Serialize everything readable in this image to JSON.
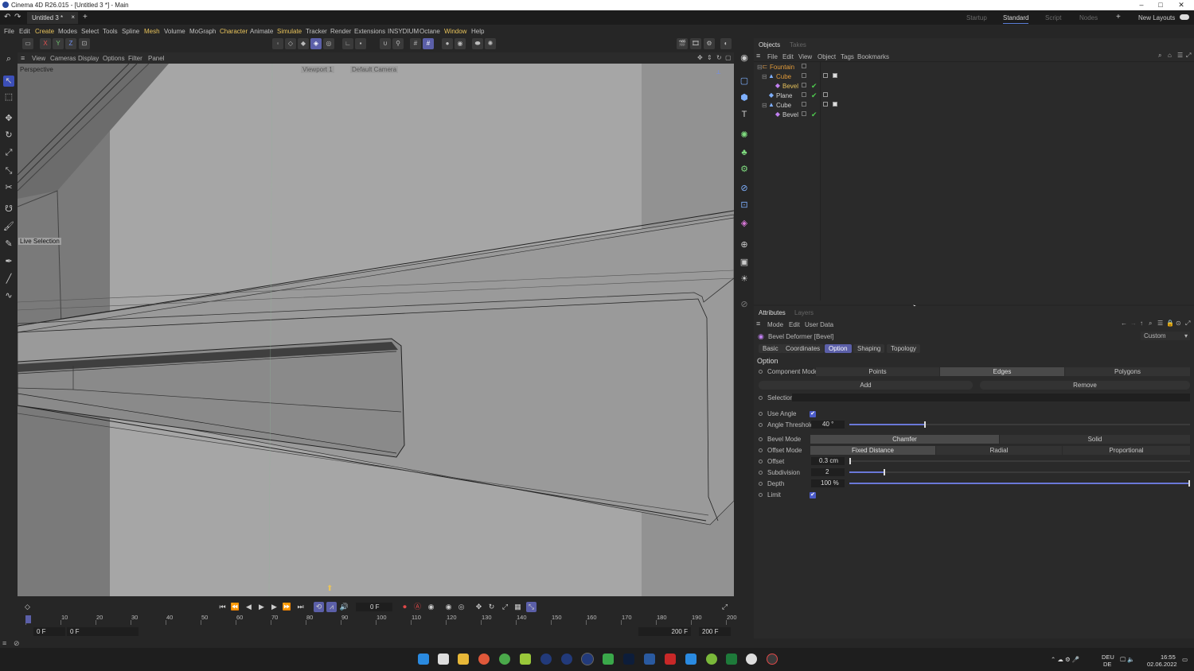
{
  "window": {
    "title": "Cinema 4D R26.015 - [Untitled 3 *] - Main",
    "controls": [
      "–",
      "□",
      "✕"
    ]
  },
  "tabbar": {
    "doc_tab": "Untitled 3 *",
    "close": "×",
    "add": "+",
    "layouts": [
      "Startup",
      "Standard",
      "Script",
      "Nodes"
    ],
    "active_layout": "Standard",
    "add_layout": "+",
    "new_layouts": "New Layouts"
  },
  "menubar": [
    "File",
    "Edit",
    "Create",
    "Modes",
    "Select",
    "Tools",
    "Spline",
    "Mesh",
    "Volume",
    "MoGraph",
    "Character",
    "Animate",
    "Simulate",
    "Tracker",
    "Render",
    "Extensions",
    "INSYDIUM",
    "Octane",
    "Window",
    "Help"
  ],
  "toolbar": {
    "axis_buttons": [
      "X",
      "Y",
      "Z"
    ]
  },
  "viewport_menu": [
    "View",
    "Cameras",
    "Display",
    "Options",
    "Filter",
    "Panel"
  ],
  "viewport": {
    "name": "Perspective",
    "viewport_label": "Viewport 1",
    "camera_label": "Default Camera",
    "tool_hint": "Live Selection"
  },
  "objects_panel": {
    "tabs": [
      "Objects",
      "Takes"
    ],
    "menu": [
      "File",
      "Edit",
      "View",
      "Object",
      "Tags",
      "Bookmarks"
    ],
    "tree": [
      {
        "name": "Fountain",
        "indent": 0,
        "color": "orange",
        "icon": "null-icon",
        "check": false
      },
      {
        "name": "Cube",
        "indent": 1,
        "color": "orange",
        "icon": "cube-icon",
        "check": true
      },
      {
        "name": "Bevel",
        "indent": 2,
        "color": "yellow",
        "icon": "bevel-icon",
        "check": true
      },
      {
        "name": "Plane",
        "indent": 1,
        "color": "white",
        "icon": "plane-icon",
        "check": true
      },
      {
        "name": "Cube",
        "indent": 1,
        "color": "white",
        "icon": "cube-icon",
        "check": false
      },
      {
        "name": "Bevel",
        "indent": 2,
        "color": "white",
        "icon": "bevel-icon",
        "check": true
      }
    ]
  },
  "attributes": {
    "tabs": [
      "Attributes",
      "Layers"
    ],
    "menu": [
      "Mode",
      "Edit",
      "User Data"
    ],
    "object_label": "Bevel Deformer [Bevel]",
    "preset": "Custom",
    "sub_tabs": [
      "Basic",
      "Coordinates",
      "Option",
      "Shaping",
      "Topology"
    ],
    "active_sub_tab": "Option",
    "section": "Option",
    "component_mode": {
      "label": "Component Mode",
      "options": [
        "Points",
        "Edges",
        "Polygons"
      ],
      "selected": "Edges"
    },
    "add_label": "Add",
    "remove_label": "Remove",
    "selection_label": "Selection",
    "use_angle": {
      "label": "Use Angle",
      "checked": true
    },
    "angle_threshold": {
      "label": "Angle Threshold",
      "value": "40 °",
      "fraction": 0.22
    },
    "bevel_mode": {
      "label": "Bevel Mode",
      "options": [
        "Chamfer",
        "Solid"
      ],
      "selected": "Chamfer"
    },
    "offset_mode": {
      "label": "Offset Mode",
      "options": [
        "Fixed Distance",
        "Radial",
        "Proportional"
      ],
      "selected": "Fixed Distance"
    },
    "offset": {
      "label": "Offset",
      "value": "0.3 cm",
      "fraction": 0.0
    },
    "subdivision": {
      "label": "Subdivision",
      "value": "2",
      "fraction": 0.1
    },
    "depth": {
      "label": "Depth",
      "value": "100 %",
      "fraction": 1.0
    },
    "limit": {
      "label": "Limit",
      "checked": true
    }
  },
  "timeline": {
    "current_frame": "0 F",
    "ticks": [
      "0",
      "10",
      "20",
      "30",
      "40",
      "50",
      "60",
      "70",
      "80",
      "90",
      "100",
      "110",
      "120",
      "130",
      "140",
      "150",
      "160",
      "170",
      "180",
      "190",
      "200"
    ],
    "start": "0 F",
    "preview_start": "0 F",
    "preview_end": "200 F",
    "end": "200 F"
  },
  "taskbar": {
    "lang": "DEU",
    "lang_sub": "DE",
    "time": "16:55",
    "date": "02.06.2022"
  },
  "colors": {
    "accent": "#5b5fa8",
    "highlight_menu": "#e8c35b",
    "object_orange": "#e09a3a",
    "check_green": "#4ec94e"
  }
}
